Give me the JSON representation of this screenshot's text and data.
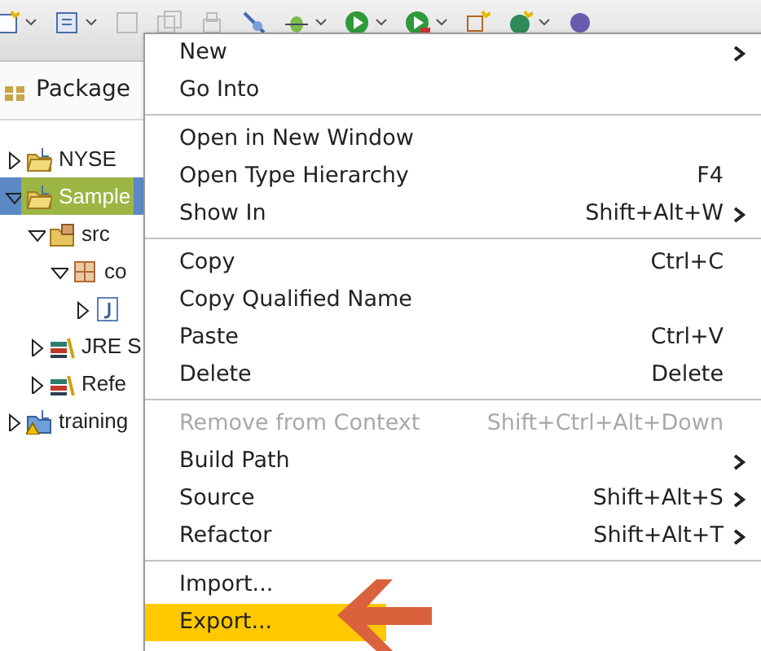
{
  "view": {
    "title": "Package"
  },
  "tree": [
    {
      "label": "NYSE",
      "kind": "project",
      "expanded": false,
      "selected": false
    },
    {
      "label": "Sample",
      "kind": "project",
      "expanded": true,
      "selected": true,
      "children": [
        {
          "label": "src",
          "kind": "source-folder",
          "expanded": true,
          "selected": false,
          "children": [
            {
              "label": "co",
              "kind": "package",
              "expanded": true,
              "selected": false,
              "children": [
                {
                  "kind": "java-file",
                  "expanded": false,
                  "selected": false
                }
              ]
            }
          ]
        },
        {
          "label": "JRE S",
          "kind": "library",
          "expanded": false,
          "selected": false
        },
        {
          "label": "Refe",
          "kind": "library",
          "expanded": false,
          "selected": false
        }
      ]
    },
    {
      "label": "training",
      "kind": "project-warning",
      "expanded": false,
      "selected": false
    }
  ],
  "context_menu": {
    "groups": [
      [
        {
          "label": "New",
          "submenu": true,
          "disabled": false,
          "selected": false
        },
        {
          "label": "Go Into",
          "submenu": false,
          "disabled": false,
          "selected": false
        }
      ],
      [
        {
          "label": "Open in New Window",
          "submenu": false,
          "disabled": false,
          "selected": false
        },
        {
          "label": "Open Type Hierarchy",
          "shortcut": "F4",
          "submenu": false,
          "disabled": false,
          "selected": false
        },
        {
          "label": "Show In",
          "shortcut": "Shift+Alt+W",
          "submenu": true,
          "disabled": false,
          "selected": false
        }
      ],
      [
        {
          "label": "Copy",
          "shortcut": "Ctrl+C",
          "submenu": false,
          "disabled": false,
          "selected": false
        },
        {
          "label": "Copy Qualified Name",
          "submenu": false,
          "disabled": false,
          "selected": false
        },
        {
          "label": "Paste",
          "shortcut": "Ctrl+V",
          "submenu": false,
          "disabled": false,
          "selected": false
        },
        {
          "label": "Delete",
          "shortcut": "Delete",
          "submenu": false,
          "disabled": false,
          "selected": false
        }
      ],
      [
        {
          "label": "Remove from Context",
          "shortcut": "Shift+Ctrl+Alt+Down",
          "submenu": false,
          "disabled": true,
          "selected": false
        },
        {
          "label": "Build Path",
          "submenu": true,
          "disabled": false,
          "selected": false
        },
        {
          "label": "Source",
          "shortcut": "Shift+Alt+S",
          "submenu": true,
          "disabled": false,
          "selected": false
        },
        {
          "label": "Refactor",
          "shortcut": "Shift+Alt+T",
          "submenu": true,
          "disabled": false,
          "selected": false
        }
      ],
      [
        {
          "label": "Import...",
          "submenu": false,
          "disabled": false,
          "selected": false
        },
        {
          "label": "Export...",
          "submenu": false,
          "disabled": false,
          "selected": true
        }
      ]
    ]
  }
}
